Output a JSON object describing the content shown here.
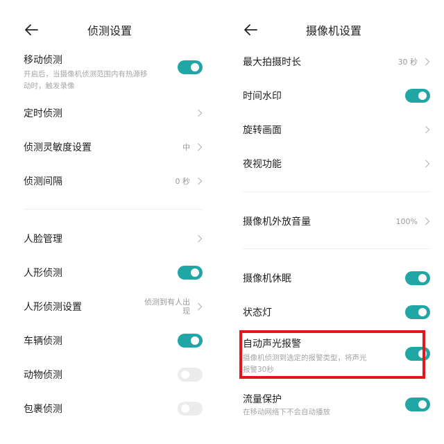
{
  "left": {
    "title": "侦测设置",
    "items": [
      {
        "label": "移动侦测",
        "sub": [
          "开启后，当摄像机侦测范围内有热源移",
          "动时，触发录像"
        ],
        "toggle": "on"
      },
      {
        "label": "定时侦测",
        "value": ""
      },
      {
        "label": "侦测灵敏度设置",
        "value": "中"
      },
      {
        "label": "侦测间隔",
        "value": "0 秒"
      },
      {
        "label": "人脸管理",
        "value": ""
      },
      {
        "label": "人形侦测",
        "toggle": "on"
      },
      {
        "label": "人形侦测设置",
        "value": [
          "侦测到有人出",
          "现"
        ]
      },
      {
        "label": "车辆侦测",
        "toggle": "on"
      },
      {
        "label": "动物侦测",
        "toggle": "off"
      },
      {
        "label": "包裹侦测",
        "toggle": "off"
      }
    ]
  },
  "right": {
    "title": "摄像机设置",
    "items": [
      {
        "label": "最大拍摄时长",
        "value": "30 秒"
      },
      {
        "label": "时间水印",
        "toggle": "on"
      },
      {
        "label": "旋转画面",
        "value": ""
      },
      {
        "label": "夜视功能",
        "value": ""
      },
      {
        "label": "摄像机外放音量",
        "value": "100%"
      },
      {
        "label": "摄像机休眠",
        "toggle": "on"
      },
      {
        "label": "状态灯",
        "toggle": "on"
      },
      {
        "label": "自动声光报警",
        "sub": [
          "摄像机侦测到选定的报警类型，将声光",
          "报警30秒"
        ],
        "toggle": "on"
      },
      {
        "label": "流量保护",
        "sub": [
          "在移动网络下不会自动播放"
        ],
        "toggle": "on"
      }
    ]
  },
  "colors": {
    "accent": "#20a7a5",
    "highlight": "#e2161b",
    "toggle_off": "#ececec"
  },
  "icons": {
    "back": "arrow-left-icon",
    "chevron": "chevron-right-icon"
  }
}
